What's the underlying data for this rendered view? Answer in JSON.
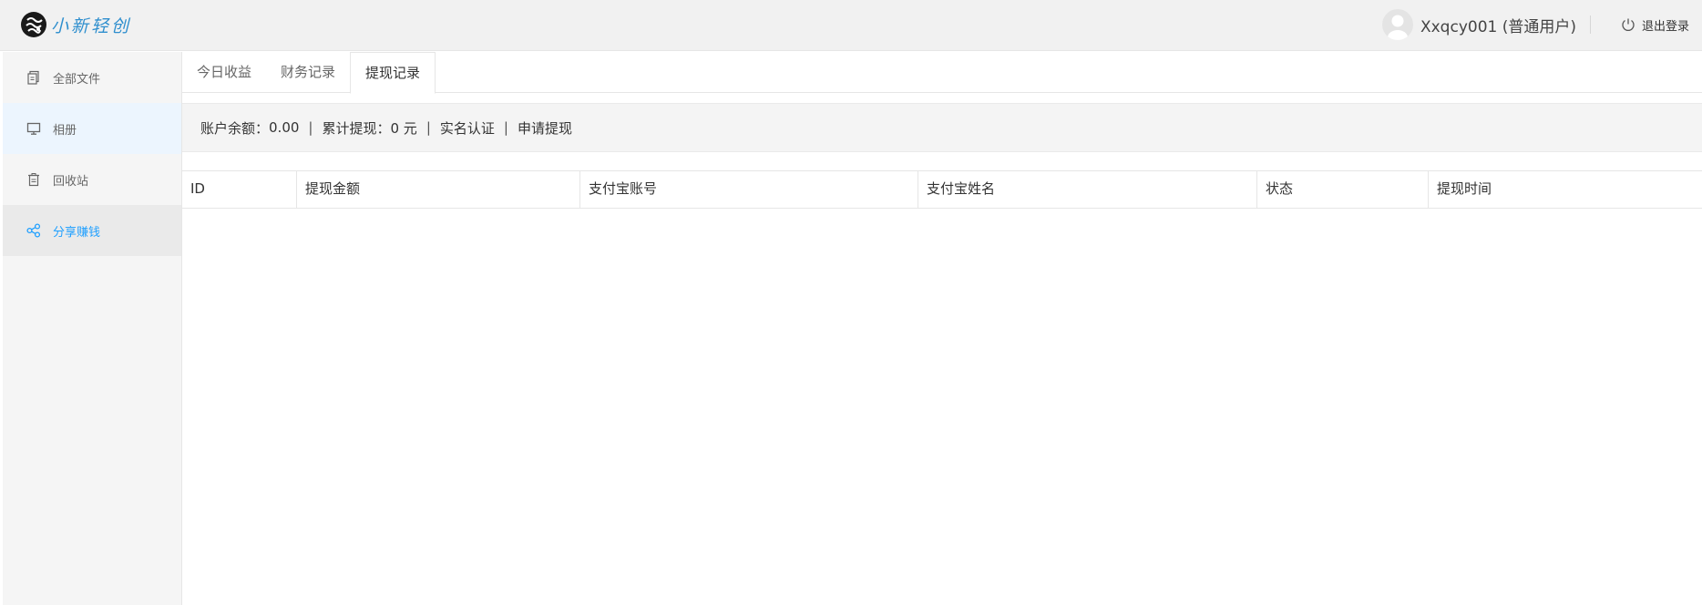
{
  "header": {
    "logo_text": "小新轻创",
    "username": "Xxqcy001 (普通用户)",
    "logout_label": "退出登录",
    "logo_icon": "logo-mark-icon",
    "avatar_icon": "default-avatar-icon",
    "logout_icon": "power-icon"
  },
  "sidebar": {
    "items": [
      {
        "label": "全部文件",
        "icon": "files-icon"
      },
      {
        "label": "相册",
        "icon": "monitor-icon"
      },
      {
        "label": "回收站",
        "icon": "trash-icon"
      },
      {
        "label": "分享赚钱",
        "icon": "share-icon"
      }
    ],
    "active_index": 3,
    "hover_index": 1,
    "active_color": "#1e9fff"
  },
  "tabs": [
    {
      "label": "今日收益"
    },
    {
      "label": "财务记录"
    },
    {
      "label": "提现记录"
    }
  ],
  "active_tab": 2,
  "infobar": {
    "balance_label": "账户余额：",
    "balance_value": "0.00",
    "withdrawn_label": "累计提现：",
    "withdrawn_value": "0 元",
    "verify_link": "实名认证",
    "apply_link": "申请提现",
    "separator": "|"
  },
  "table": {
    "columns": [
      "ID",
      "提现金额",
      "支付宝账号",
      "支付宝姓名",
      "状态",
      "提现时间"
    ],
    "rows": []
  }
}
